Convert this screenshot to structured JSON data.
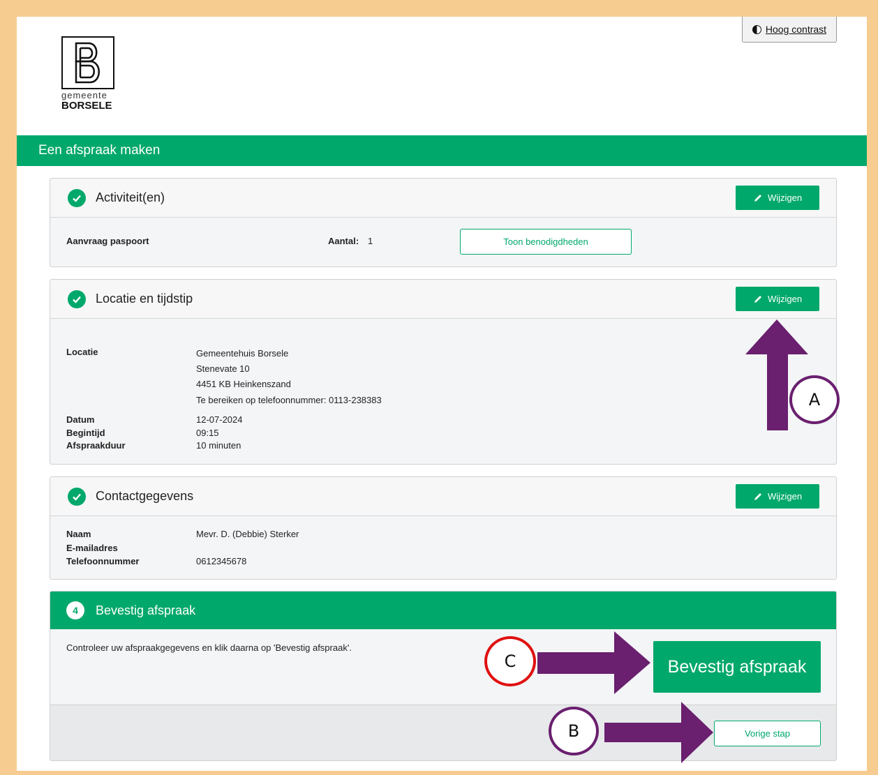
{
  "header": {
    "logo": {
      "municipality_prefix": "gemeente",
      "municipality_name": "BORSELE"
    },
    "contrast_button": "Hoog contrast"
  },
  "banner": {
    "title": "Een afspraak maken"
  },
  "activities": {
    "title": "Activiteit(en)",
    "edit_label": "Wijzigen",
    "item": "Aanvraag paspoort",
    "count_label": "Aantal:",
    "count_value": "1",
    "requirements_button": "Toon benodigdheden"
  },
  "location": {
    "title": "Locatie en tijdstip",
    "edit_label": "Wijzigen",
    "location_label": "Locatie",
    "location_lines": [
      "Gemeentehuis Borsele",
      "Stenevate 10",
      "4451 KB Heinkenszand",
      "Te bereiken op telefoonnummer: 0113-238383"
    ],
    "date_label": "Datum",
    "date_value": "12-07-2024",
    "start_label": "Begintijd",
    "start_value": "09:15",
    "duration_label": "Afspraakduur",
    "duration_value": "10 minuten"
  },
  "contact": {
    "title": "Contactgegevens",
    "edit_label": "Wijzigen",
    "name_label": "Naam",
    "name_value": "Mevr. D. (Debbie) Sterker",
    "email_label": "E-mailadres",
    "email_value": "",
    "phone_label": "Telefoonnummer",
    "phone_value": "0612345678"
  },
  "confirm": {
    "step": "4",
    "title": "Bevestig afspraak",
    "instruction": "Controleer uw afspraakgegevens en klik daarna op 'Bevestig afspraak'.",
    "confirm_button": "Bevestig afspraak",
    "previous_button": "Vorige stap"
  },
  "annotations": {
    "a": "A",
    "b": "B",
    "c": "C",
    "arrow_color": "#6a1f6f",
    "highlight_ring_color": "#e01010"
  },
  "colors": {
    "brand_green": "#00a86b",
    "frame": "#f7cc91"
  }
}
